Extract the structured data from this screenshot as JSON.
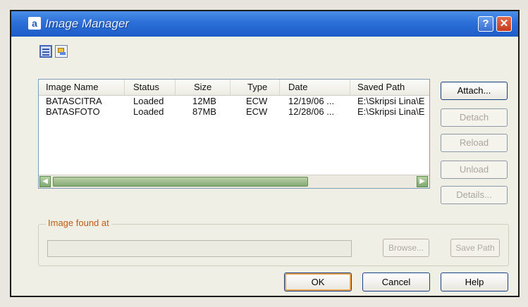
{
  "window": {
    "title": "Image Manager",
    "app_icon": "a",
    "help_glyph": "?",
    "close_glyph": "✕"
  },
  "list": {
    "columns": [
      "Image Name",
      "Status",
      "Size",
      "Type",
      "Date",
      "Saved Path"
    ],
    "rows": [
      [
        "BATASCITRA",
        "Loaded",
        "12MB",
        "ECW",
        "12/19/06 ...",
        "E:\\Skripsi Lina\\E"
      ],
      [
        "BATASFOTO",
        "Loaded",
        "87MB",
        "ECW",
        "12/28/06 ...",
        "E:\\Skripsi Lina\\E"
      ]
    ],
    "scroll_left": "◀",
    "scroll_right": "▶"
  },
  "side_buttons": {
    "attach": "Attach...",
    "detach": "Detach",
    "reload": "Reload",
    "unload": "Unload",
    "details": "Details..."
  },
  "found": {
    "label": "Image found at",
    "path_value": "",
    "browse": "Browse...",
    "save_path": "Save Path"
  },
  "buttons": {
    "ok": "OK",
    "cancel": "Cancel",
    "help": "Help"
  },
  "colors": {
    "titlebar": "#2b6fd8",
    "group_label": "#c25a16",
    "scroll_green": "#86aa74"
  }
}
